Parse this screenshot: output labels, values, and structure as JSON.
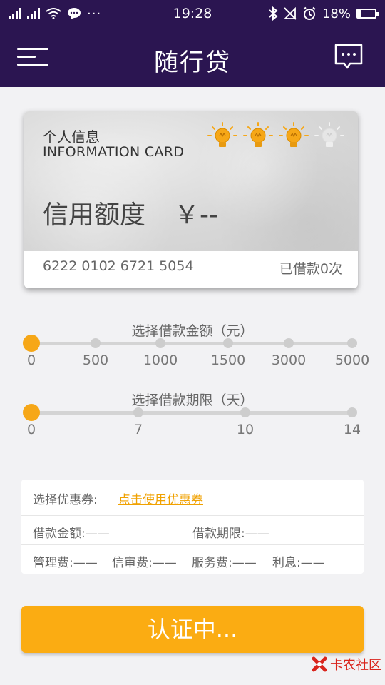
{
  "status_bar": {
    "time": "19:28",
    "battery": "18%",
    "battery_level": 0.18,
    "icons": [
      "signal-icon",
      "signal-2-icon",
      "wifi-icon",
      "message-icon",
      "more-icon",
      "bluetooth-icon",
      "no-signal-icon",
      "alarm-icon",
      "battery-icon"
    ]
  },
  "header": {
    "title": "随行贷",
    "left_icon": "menu-icon",
    "right_icon": "chat-icon"
  },
  "card": {
    "label_cn": "个人信息",
    "label_en": "INFORMATION CARD",
    "credit_label": "信用额度",
    "credit_value": "￥--",
    "card_number": "6222 0102 6721 5054",
    "borrow_count": "已借款0次",
    "bulbs_lit": 3,
    "bulbs_total": 4,
    "bulb_color": "#f6a717"
  },
  "amount_slider": {
    "title": "选择借款金额（元）",
    "ticks": [
      "0",
      "500",
      "1000",
      "1500",
      "3000",
      "5000"
    ],
    "selected_index": 0
  },
  "term_slider": {
    "title": "选择借款期限（天）",
    "ticks": [
      "0",
      "7",
      "10",
      "14"
    ],
    "selected_index": 0
  },
  "info": {
    "coupon_label": "选择优惠券:",
    "coupon_link": "点击使用优惠券",
    "amount_label": "借款金额:——",
    "term_label": "借款期限:——",
    "mgmt_fee": "管理费:——",
    "credit_fee": "信审费:——",
    "service_fee": "服务费:——",
    "interest": "利息:——"
  },
  "submit_label": "认证中...",
  "watermark": "卡农社区",
  "colors": {
    "header_bg": "#2b1551",
    "accent": "#fbac12",
    "link": "#f0a100"
  }
}
